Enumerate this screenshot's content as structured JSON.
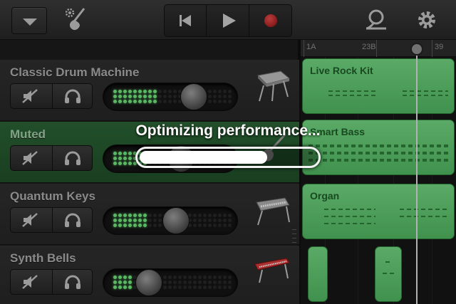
{
  "toolbar": {
    "menu_icon": "dropdown-triangle-icon",
    "instrument_settings_icon": "guitar-settings-icon",
    "transport": [
      "rewind-icon",
      "play-icon",
      "record-icon"
    ],
    "loop_icon": "loop-browser-icon",
    "settings_icon": "gear-icon",
    "record_color": "#c81e1e"
  },
  "ruler": {
    "labels": [
      "1A",
      "23B",
      "39"
    ]
  },
  "tracks": [
    {
      "name": "Classic Drum Machine",
      "icon": "drum-machine-icon",
      "level": 0.72,
      "muted": false
    },
    {
      "name": "Muted",
      "icon": "guitar-icon",
      "level": 0.6,
      "muted": true
    },
    {
      "name": "Quantum Keys",
      "icon": "synth-keyboard-icon",
      "level": 0.55,
      "muted": false
    },
    {
      "name": "Synth Bells",
      "icon": "red-keyboard-icon",
      "level": 0.3,
      "muted": false
    }
  ],
  "regions": [
    {
      "name": "Live Rock Kit"
    },
    {
      "name": "Smart Bass"
    },
    {
      "name": "Organ"
    },
    {
      "name": ""
    },
    {
      "name": ""
    }
  ],
  "overlay": {
    "message": "Optimizing performance...",
    "progress": 0.72
  },
  "colors": {
    "region_green": "#5fc26e",
    "muted_track": "#2a6234",
    "led_on": "#6ee07a"
  }
}
